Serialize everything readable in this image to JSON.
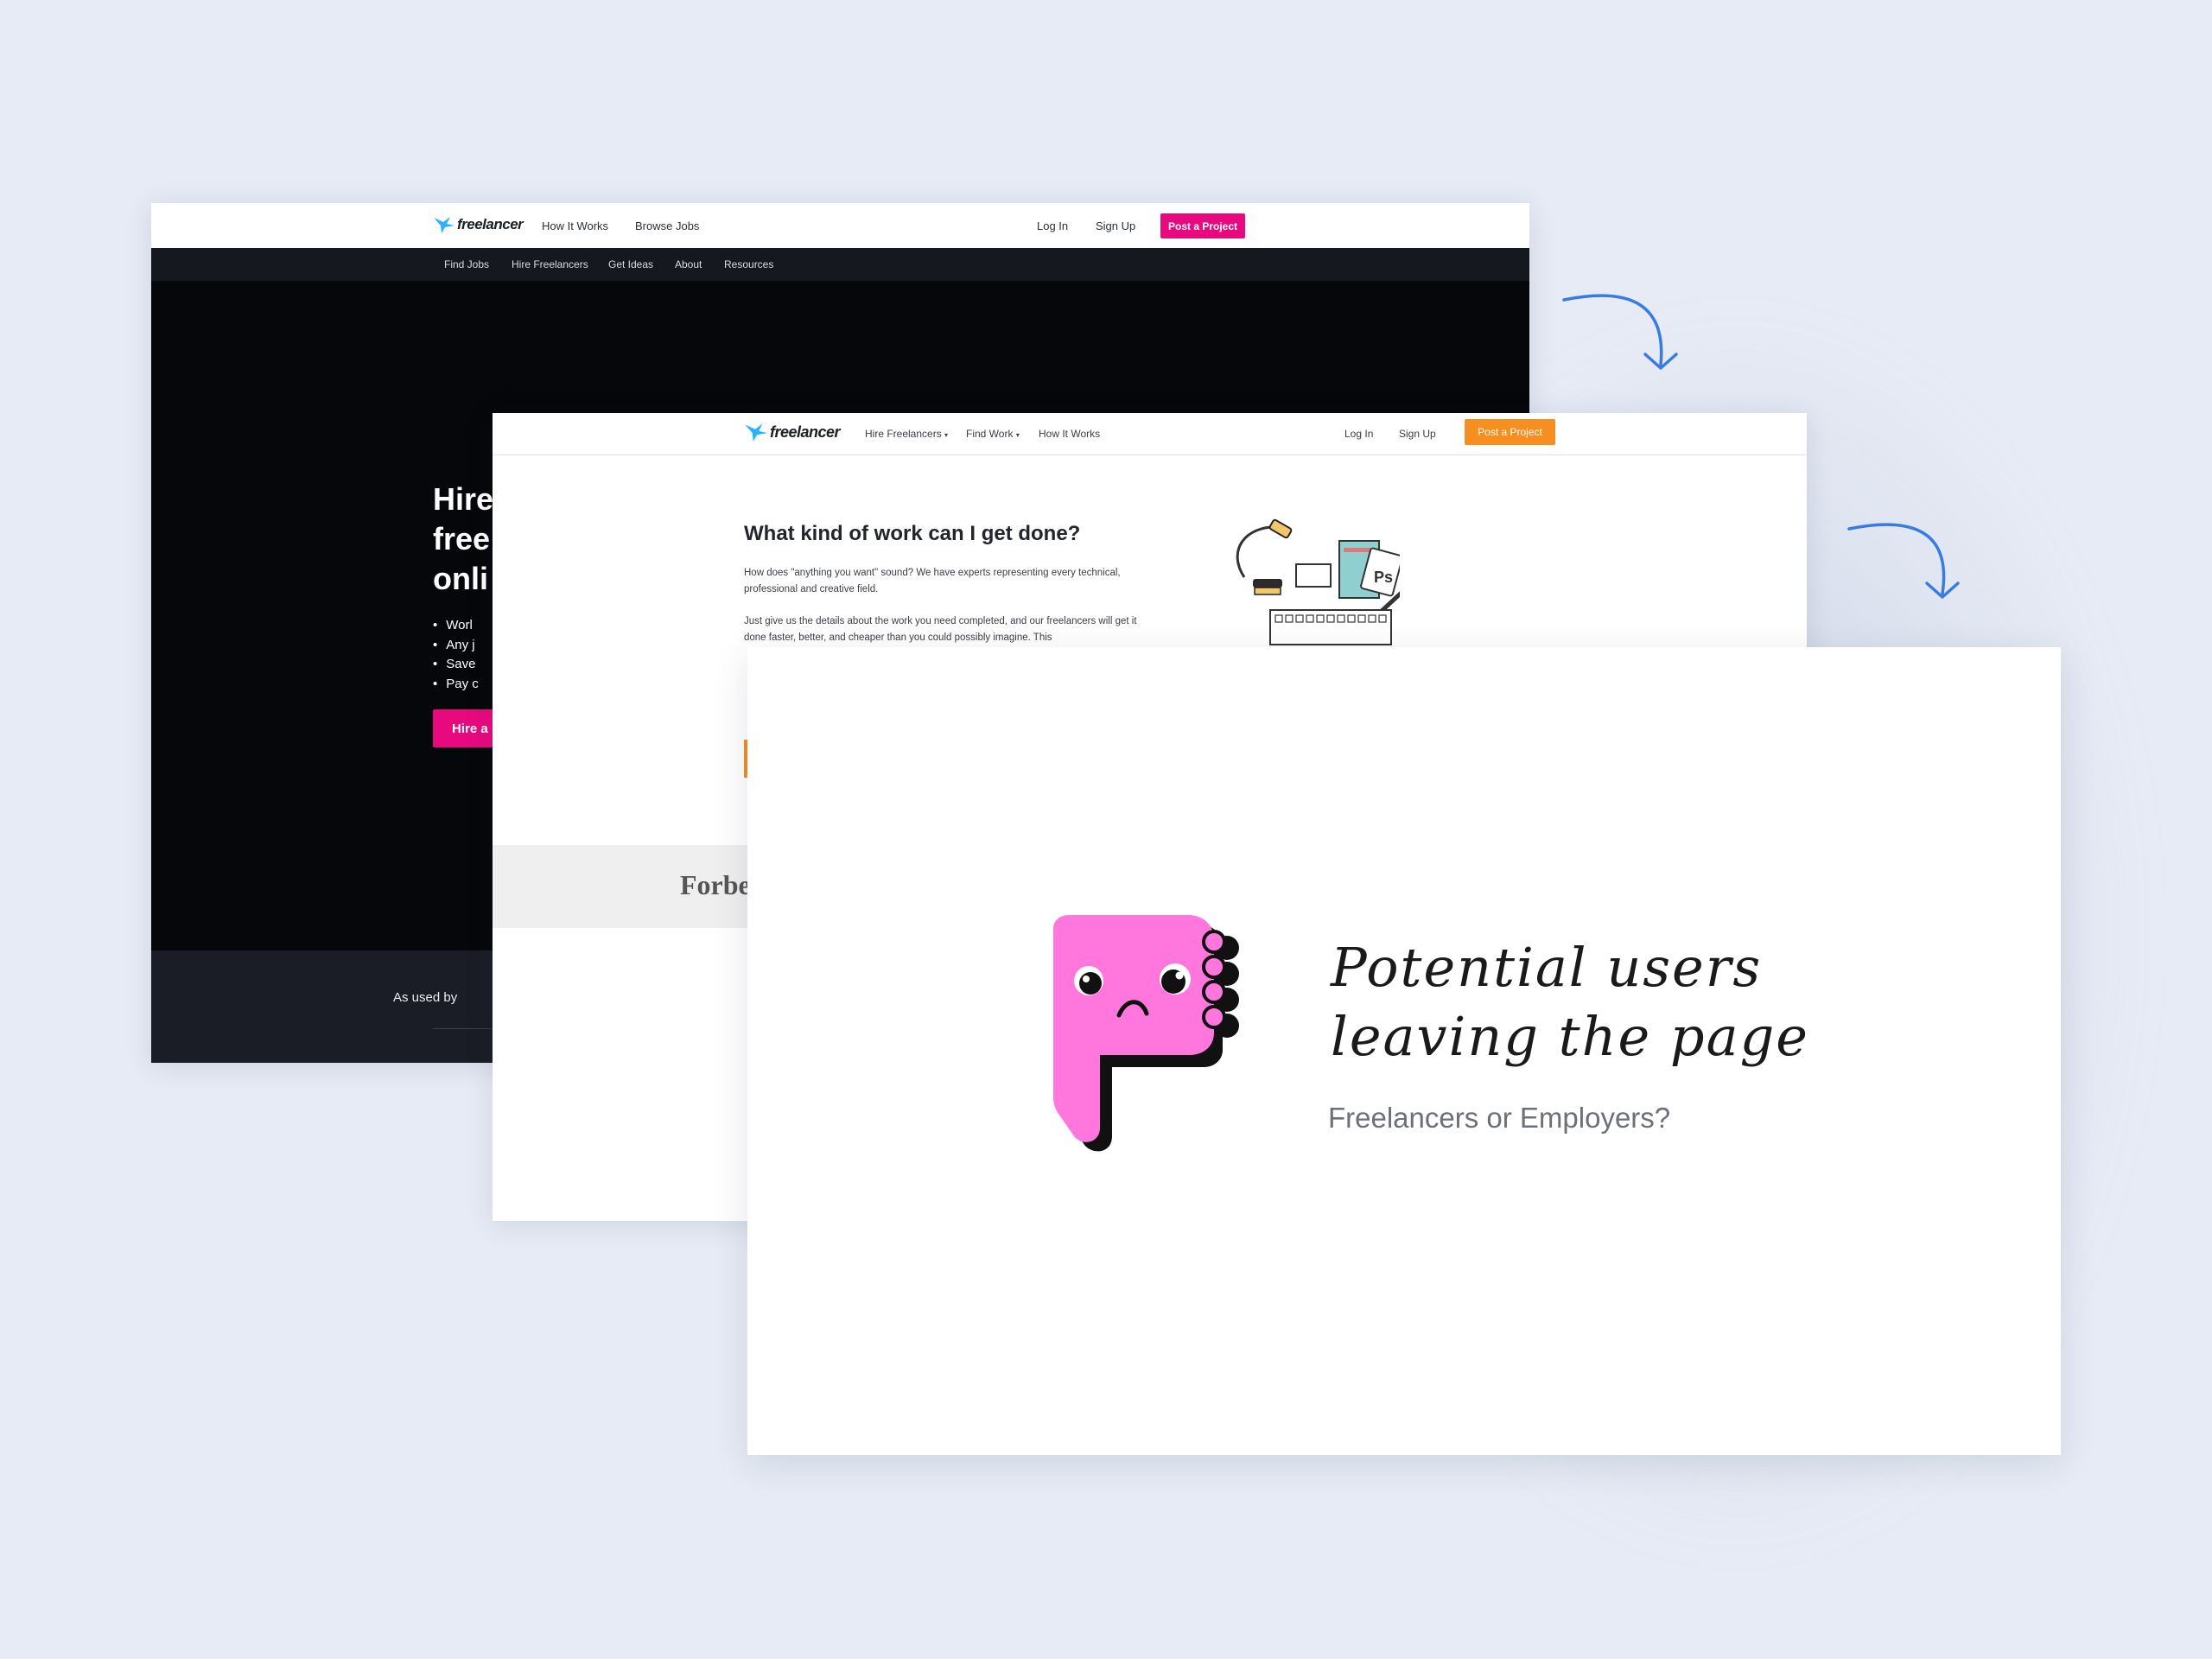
{
  "background_color": "#e6ebf5",
  "screen_old": {
    "logo": "freelancer",
    "top_nav": [
      "How It Works",
      "Browse Jobs"
    ],
    "login": "Log In",
    "signup": "Sign Up",
    "cta": "Post a Project",
    "sub_nav": [
      "Find Jobs",
      "Hire Freelancers",
      "Get Ideas",
      "About",
      "Resources"
    ],
    "hero_title_lines": [
      "Hire",
      "free",
      "onli"
    ],
    "hero_bullets": [
      "Worl",
      "Any j",
      "Save",
      "Pay c"
    ],
    "hero_button": "Hire a",
    "used_by": "As used by",
    "accent_color": "#e8097f"
  },
  "screen_new": {
    "logo": "freelancer",
    "nav": [
      "Hire Freelancers",
      "Find Work",
      "How It Works"
    ],
    "login": "Log In",
    "signup": "Sign Up",
    "cta": "Post a Project",
    "heading": "What kind of work can I get done?",
    "para1": "How does \"anything you want\" sound? We have experts representing every technical, professional and creative field.",
    "para2": "Just give us the details about the work you need completed, and our freelancers will get it done faster, better, and cheaper than you could possibly imagine. This",
    "press_logo": "Forbe",
    "accent_color": "#f68f1f"
  },
  "slide": {
    "title_line1": "Potential users",
    "title_line2": "leaving the page",
    "subtitle": "Freelancers or Employers?",
    "mascot": "thumbs-down-sad-icon",
    "mascot_color": "#ff77dd"
  }
}
